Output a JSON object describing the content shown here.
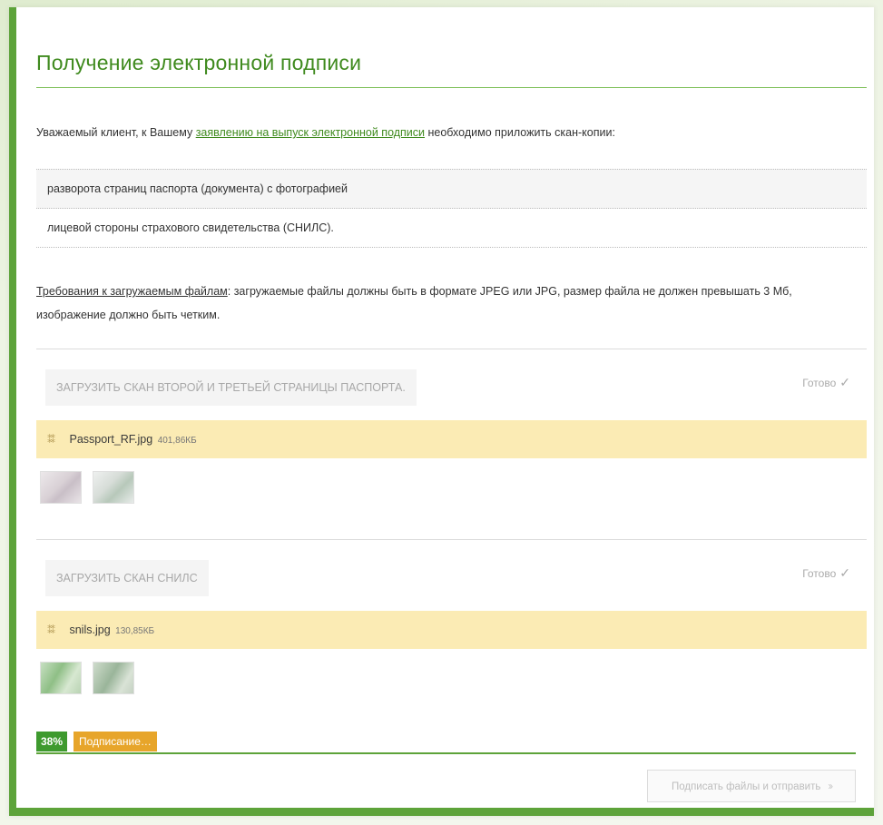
{
  "page": {
    "title": "Получение электронной подписи",
    "intro_before": "Уважаемый клиент, к Вашему ",
    "intro_link": "заявлению на выпуск электронной подписи",
    "intro_after": " необходимо приложить скан-копии:"
  },
  "documents": [
    "разворота страниц паспорта (документа) с фотографией",
    "лицевой стороны страхового свидетельства (СНИЛС)."
  ],
  "requirements": {
    "label": "Требования к загружаемым файлам",
    "text": ": загружаемые файлы должны быть в формате JPEG или JPG, размер файла не должен превышать 3 Мб, изображение должно быть четким."
  },
  "uploads": [
    {
      "button_label": "ЗАГРУЗИТЬ СКАН ВТОРОЙ И ТРЕТЬЕЙ СТРАНИЦЫ ПАСПОРТА.",
      "status": "Готово",
      "file_name": "Passport_RF.jpg",
      "file_size": "401,86КБ"
    },
    {
      "button_label": "ЗАГРУЗИТЬ СКАН СНИЛС",
      "status": "Готово",
      "file_name": "snils.jpg",
      "file_size": "130,85КБ"
    }
  ],
  "progress": {
    "percent_label": "38%",
    "percent_value": 38,
    "status": "Подписание…"
  },
  "actions": {
    "submit_label": "Подписать файлы и отправить"
  },
  "colors": {
    "accent": "#5da33a",
    "title": "#3f8a1e",
    "file_row": "#fbebb4",
    "status_badge": "#e7a52a"
  },
  "icons": {
    "drag_handle": "drag-handle-icon",
    "check": "check-icon",
    "submit_arrow": "double-chevron-right-icon"
  }
}
